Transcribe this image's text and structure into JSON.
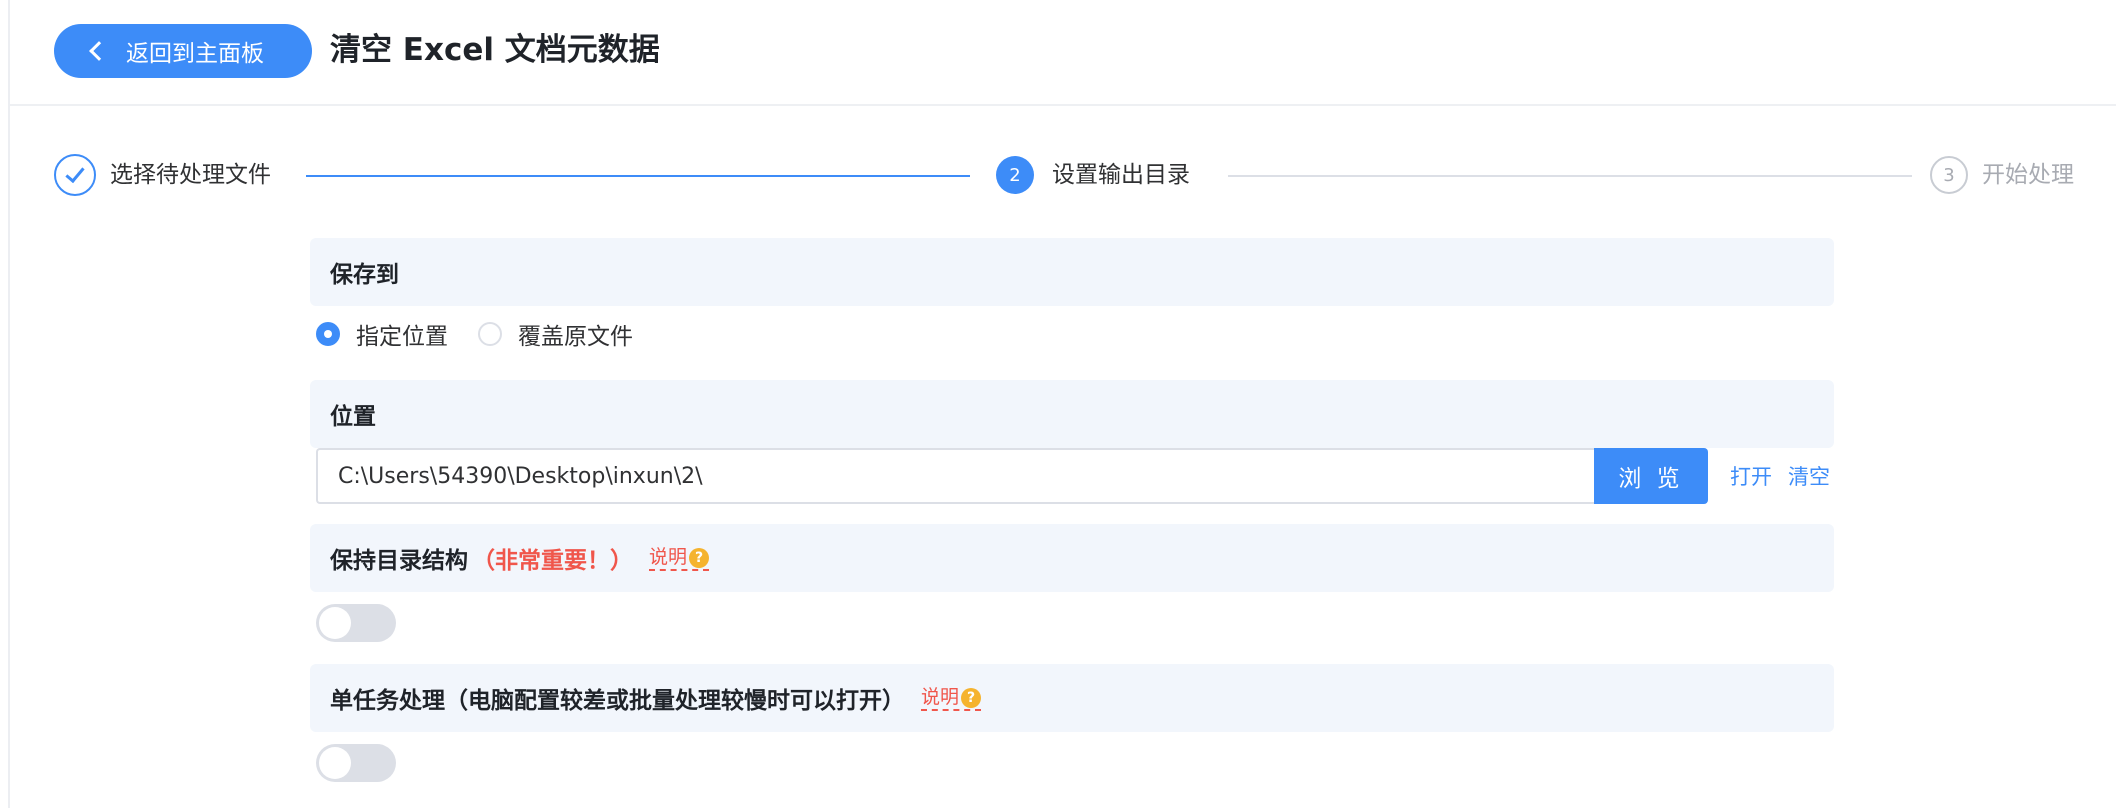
{
  "header": {
    "back_label": "返回到主面板",
    "title": "清空 Excel 文档元数据"
  },
  "steps": [
    {
      "index": "✓",
      "label": "选择待处理文件",
      "status": "done"
    },
    {
      "index": "2",
      "label": "设置输出目录",
      "status": "active"
    },
    {
      "index": "3",
      "label": "开始处理",
      "status": "wait"
    }
  ],
  "save_to": {
    "title": "保存到",
    "options": [
      "指定位置",
      "覆盖原文件"
    ],
    "selected": "指定位置"
  },
  "location": {
    "title": "位置",
    "path_value": "C:\\Users\\54390\\Desktop\\inxun\\2\\",
    "browse_label": "浏 览",
    "open_label": "打开",
    "clear_label": "清空"
  },
  "keep_structure": {
    "title": "保持目录结构",
    "warning": "（非常重要！）",
    "explain_label": "说明",
    "enabled": false
  },
  "single_task": {
    "title": "单任务处理（电脑配置较差或批量处理较慢时可以打开）",
    "explain_label": "说明",
    "enabled": false
  },
  "colors": {
    "accent": "#3d8cf8",
    "warning": "#f0564b",
    "panel_bg": "#f2f6fc"
  }
}
